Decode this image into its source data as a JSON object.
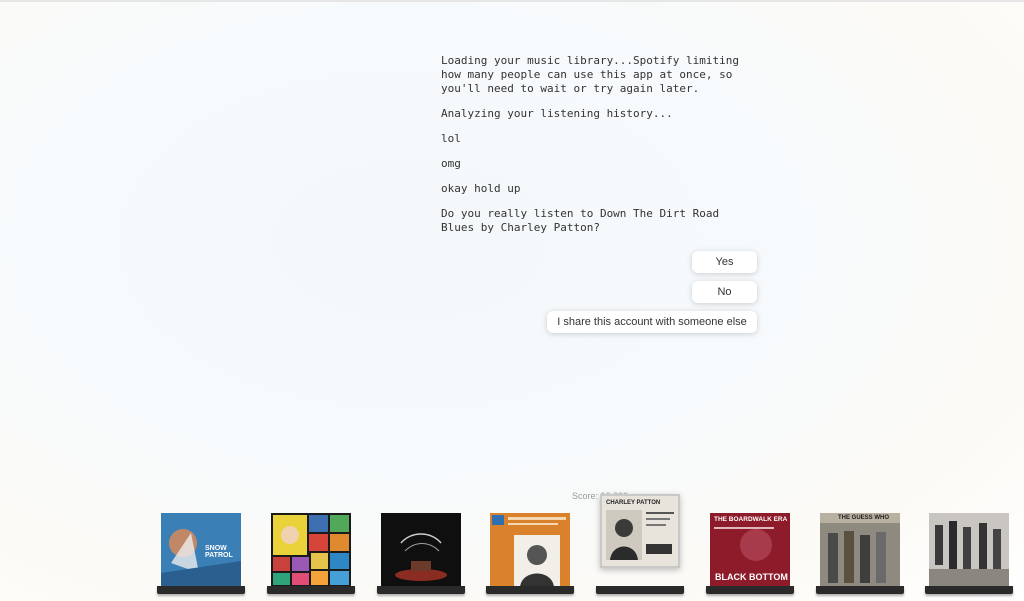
{
  "chat": {
    "messages": [
      "Loading your music library...Spotify limiting how many people can use this app at once, so you'll need to wait or try again later.",
      "Analyzing your listening history...",
      "lol",
      "omg",
      "okay hold up",
      "Do you really listen to Down The Dirt Road Blues by Charley Patton?"
    ]
  },
  "options": {
    "yes": "Yes",
    "no": "No",
    "share": "I share this account with someone else"
  },
  "score": {
    "label": "Score: 10,000"
  },
  "albums": [
    {
      "cover_text": "SNOW PATROL",
      "bg": "#3b7fb7"
    },
    {
      "cover_text": "",
      "bg": "#e9d23a"
    },
    {
      "cover_text": "",
      "bg": "#111111"
    },
    {
      "cover_text": "",
      "bg": "#d9822b"
    },
    {
      "cover_text": "CHARLEY PATTON",
      "bg": "#e8e4dc"
    },
    {
      "cover_text": "THE BOARDWALK ERA",
      "bottom_text": "BLACK BOTTOM",
      "bg": "#8e1b2a"
    },
    {
      "cover_text": "THE GUESS WHO",
      "bg": "#b8b0a0"
    },
    {
      "cover_text": "",
      "bg": "#c9c6c1"
    }
  ]
}
